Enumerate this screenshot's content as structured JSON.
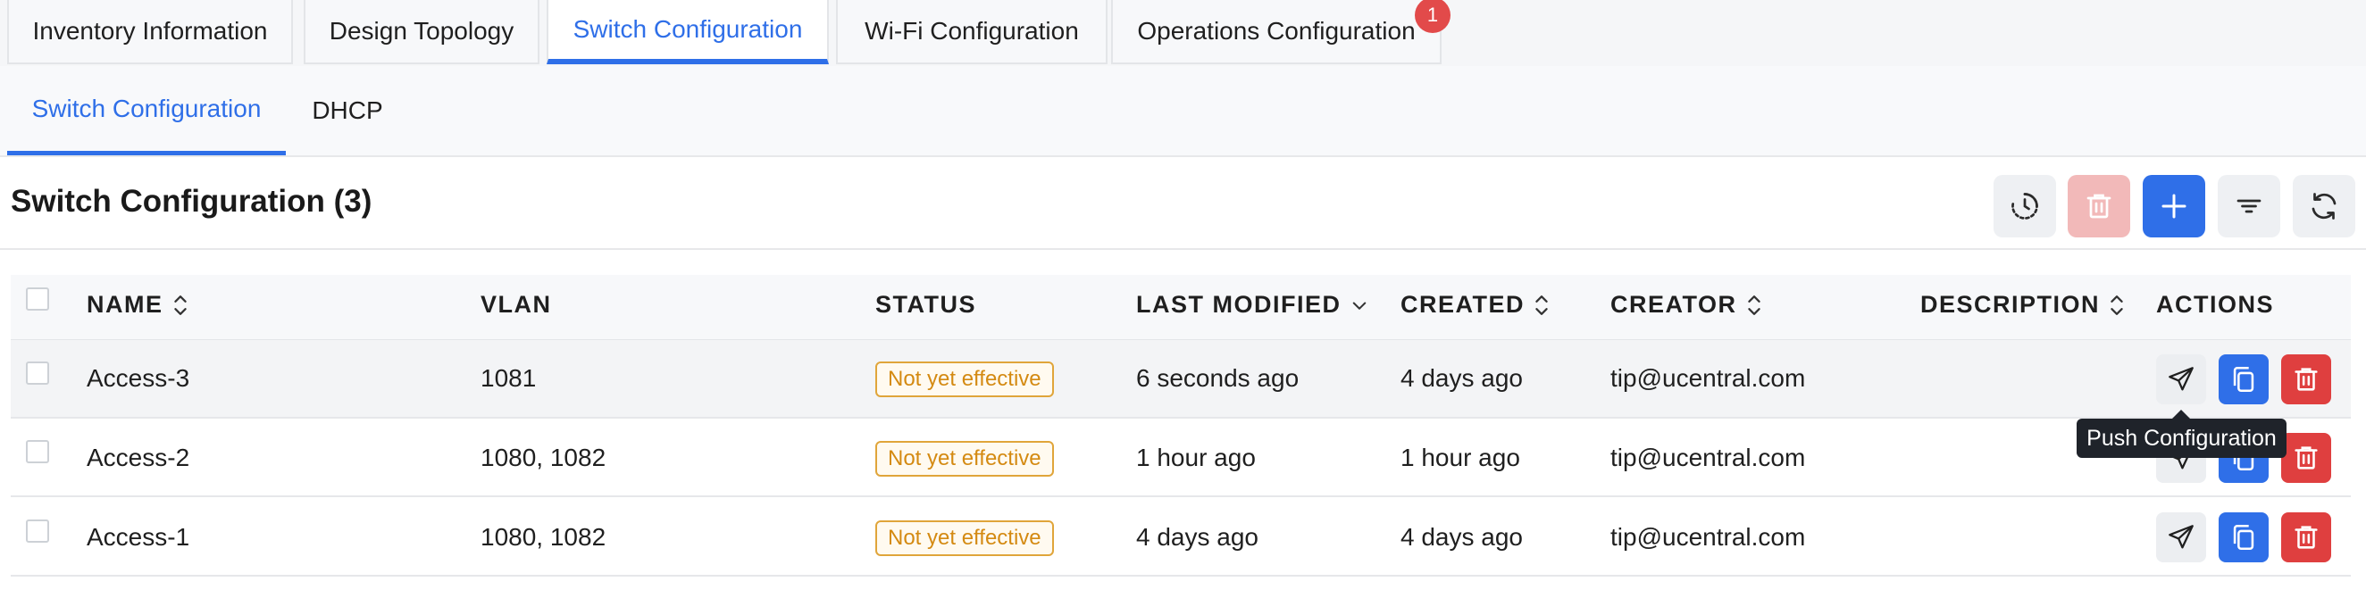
{
  "top_tabs": [
    {
      "label": "Inventory Information"
    },
    {
      "label": "Design Topology"
    },
    {
      "label": "Switch Configuration"
    },
    {
      "label": "Wi-Fi Configuration"
    },
    {
      "label": "Operations Configuration",
      "badge": "1"
    }
  ],
  "sub_tabs": [
    {
      "label": "Switch Configuration"
    },
    {
      "label": "DHCP"
    }
  ],
  "page": {
    "title": "Switch Configuration (3)"
  },
  "toolbar_icons": [
    "history-icon",
    "trash-icon",
    "plus-icon",
    "filter-icon",
    "refresh-icon"
  ],
  "colors": {
    "accent": "#2f6fe8",
    "danger": "#df3f3f",
    "danger_disabled": "#f2b9b9",
    "status_border": "#e0a53a",
    "status_text": "#d48a12",
    "badge": "#e24a4a"
  },
  "table": {
    "columns": [
      "NAME",
      "VLAN",
      "STATUS",
      "LAST MODIFIED",
      "CREATED",
      "CREATOR",
      "DESCRIPTION",
      "ACTIONS"
    ],
    "rows": [
      {
        "name": "Access-3",
        "vlan": "1081",
        "status": "Not yet effective",
        "last_modified": "6 seconds ago",
        "created": "4 days ago",
        "creator": "tip@ucentral.com",
        "description": ""
      },
      {
        "name": "Access-2",
        "vlan": "1080, 1082",
        "status": "Not yet effective",
        "last_modified": "1 hour ago",
        "created": "1 hour ago",
        "creator": "tip@ucentral.com",
        "description": ""
      },
      {
        "name": "Access-1",
        "vlan": "1080, 1082",
        "status": "Not yet effective",
        "last_modified": "4 days ago",
        "created": "4 days ago",
        "creator": "tip@ucentral.com",
        "description": ""
      }
    ]
  },
  "tooltip": {
    "text": "Push Configuration"
  }
}
